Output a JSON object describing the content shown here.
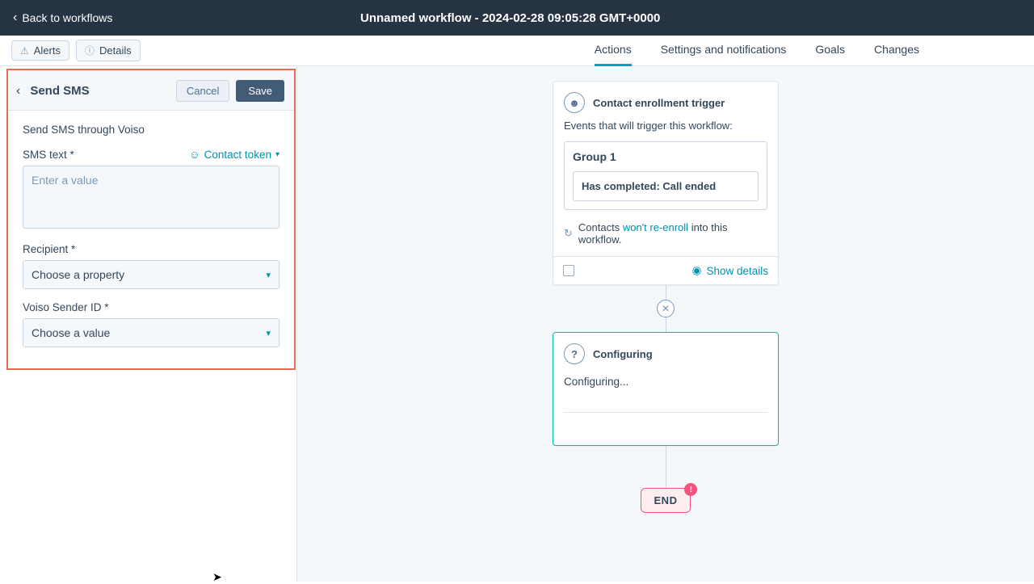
{
  "header": {
    "back_label": "Back to workflows",
    "title": "Unnamed workflow - 2024-02-28 09:05:28 GMT+0000"
  },
  "subbar": {
    "alerts": "Alerts",
    "details": "Details",
    "tabs": {
      "actions": "Actions",
      "settings": "Settings and notifications",
      "goals": "Goals",
      "changes": "Changes"
    }
  },
  "panel": {
    "title": "Send SMS",
    "cancel": "Cancel",
    "save": "Save",
    "description": "Send SMS through Voiso",
    "sms_label": "SMS text *",
    "token_label": "Contact token",
    "sms_placeholder": "Enter a value",
    "recipient_label": "Recipient *",
    "recipient_placeholder": "Choose a property",
    "sender_label": "Voiso Sender ID *",
    "sender_placeholder": "Choose a value"
  },
  "canvas": {
    "trigger": {
      "title": "Contact enrollment trigger",
      "subtitle": "Events that will trigger this workflow:",
      "group_name": "Group 1",
      "rule": "Has completed: Call ended",
      "re_pre": "Contacts ",
      "re_link": "won't re-enroll",
      "re_post": " into this workflow.",
      "show_details": "Show details"
    },
    "config": {
      "title": "Configuring",
      "body": "Configuring..."
    },
    "end": {
      "label": "END",
      "badge": "!"
    }
  }
}
